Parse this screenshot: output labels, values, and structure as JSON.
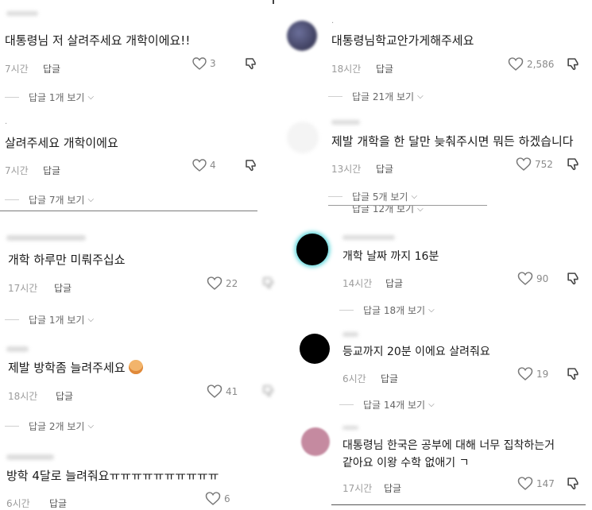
{
  "left": {
    "comments": [
      {
        "text": "대통령님 저 살려주세요 개학이에요!!",
        "time": "7시간",
        "reply": "답글",
        "likes": "3",
        "more": "답글 1개 보기"
      },
      {
        "text": "살려주세요 개학이에요",
        "time": "7시간",
        "reply": "답글",
        "likes": "4",
        "more": "답글 7개 보기"
      },
      {
        "text": "개학 하루만 미뤄주십쇼",
        "time": "17시간",
        "reply": "답글",
        "likes": "22",
        "more": "답글 1개 보기"
      },
      {
        "text": "제발 방학좀 늘려주세요",
        "time": "18시간",
        "reply": "답글",
        "likes": "41",
        "more": "답글 2개 보기"
      },
      {
        "text": "방학 4달로 늘려줘요ㅠㅠㅠㅠㅠㅠㅠㅠㅠㅠ",
        "time": "6시간",
        "reply": "답글",
        "likes": "6"
      }
    ]
  },
  "right": {
    "comments": [
      {
        "text": "대통령님학교안가게해주세요",
        "time": "18시간",
        "reply": "답글",
        "likes": "2,586",
        "more": "답글 21개 보기"
      },
      {
        "text": "제발 개학을 한 달만 늦춰주시면 뭐든 하겠습니다",
        "time": "13시간",
        "reply": "답글",
        "likes": "752",
        "more": "답글 5개 보기",
        "more2": "답글 12개 보기"
      },
      {
        "text": "개학 날짜 까지 16분",
        "time": "14시간",
        "reply": "답글",
        "likes": "90",
        "more": "답글 18개 보기"
      },
      {
        "text": "등교까지 20분 이에요 살려줘요",
        "time": "6시간",
        "reply": "답글",
        "likes": "19",
        "more": "답글 14개 보기"
      },
      {
        "text": "대통령님 한국은 공부에 대해 너무 집착하는거",
        "text2": "같아요 이왕 수학 없애기 ㄱ",
        "time": "17시간",
        "reply": "답글",
        "likes": "147"
      }
    ]
  },
  "icons": {
    "like": "heart-icon",
    "dislike": "dislike-icon",
    "more": "chevron-down-icon"
  }
}
